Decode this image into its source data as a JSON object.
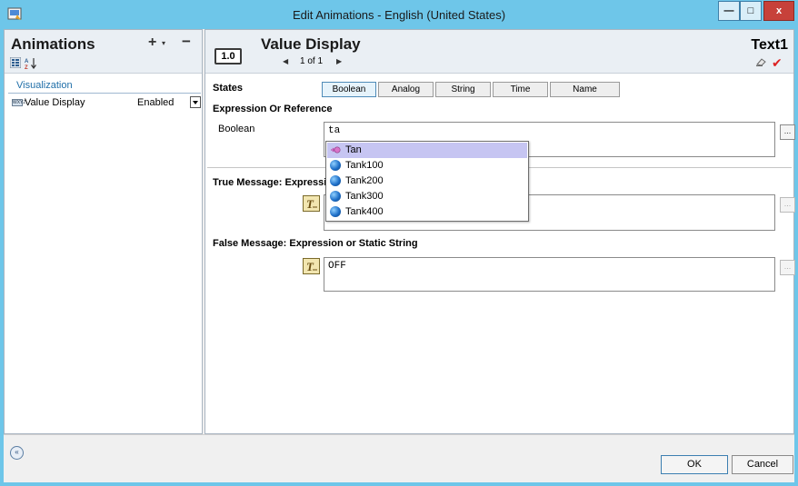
{
  "window": {
    "title": "Edit Animations - English (United States)",
    "min_glyph": "—",
    "max_glyph": "□",
    "close_glyph": "x"
  },
  "animations_panel": {
    "title": "Animations",
    "add_glyph": "+",
    "add_caret": "▾",
    "remove_glyph": "−",
    "group": "Visualization",
    "item": {
      "icon_text": "WXYZ",
      "name": "Value Display",
      "status": "Enabled"
    }
  },
  "detail_panel": {
    "value_icon_text": "1.0",
    "title": "Value Display",
    "prev_glyph": "◀",
    "page_indicator": "1 of 1",
    "next_glyph": "▶",
    "object_name": "Text1",
    "check_glyph": "✔",
    "states_label": "States",
    "state_tabs": [
      "Boolean",
      "Analog",
      "String",
      "Time",
      "Name"
    ],
    "expression_label": "Expression Or Reference",
    "boolean_label": "Boolean",
    "expression_value": "ta",
    "ellipsis": "...",
    "true_label": "True Message: Expressio",
    "true_value": "",
    "false_label": "False Message: Expression or Static String",
    "false_value": "OFF"
  },
  "autocomplete": [
    {
      "label": "Tan",
      "kind": "function",
      "selected": true
    },
    {
      "label": "Tank100",
      "kind": "tag",
      "selected": false
    },
    {
      "label": "Tank200",
      "kind": "tag",
      "selected": false
    },
    {
      "label": "Tank300",
      "kind": "tag",
      "selected": false
    },
    {
      "label": "Tank400",
      "kind": "tag",
      "selected": false
    }
  ],
  "footer": {
    "collapse_glyph": "«",
    "ok_label": "OK",
    "cancel_label": "Cancel"
  },
  "colors": {
    "title_bar": "#6ec6e9",
    "selection": "#c6c5f2",
    "group_text": "#1f6ea8"
  }
}
